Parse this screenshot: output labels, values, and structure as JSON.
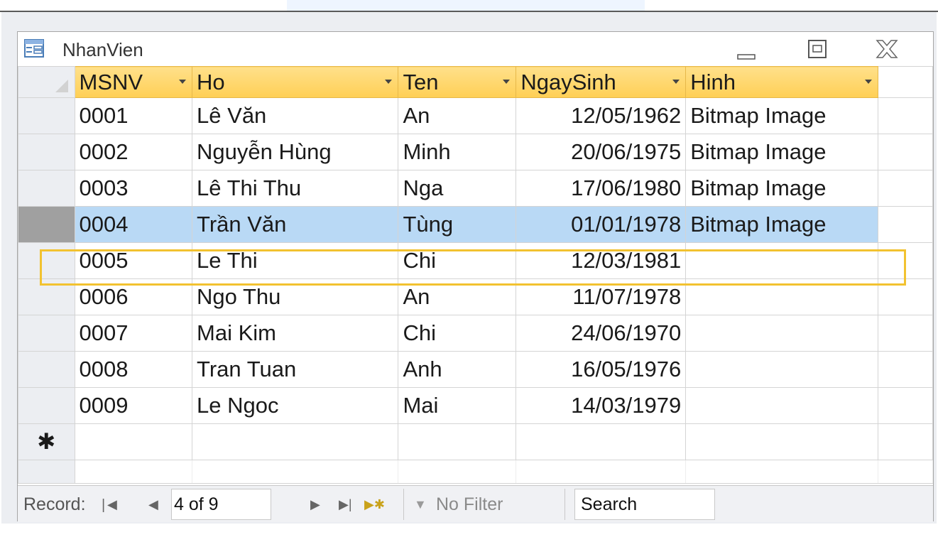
{
  "window": {
    "title": "NhanVien",
    "icon": "datasheet-icon",
    "controls": [
      "minimize-icon",
      "maximize-icon",
      "close-icon"
    ]
  },
  "table": {
    "columns": [
      "MSNV",
      "Ho",
      "Ten",
      "NgaySinh",
      "Hinh"
    ],
    "rows": [
      [
        "0001",
        "Lê Văn",
        "An",
        "12/05/1962",
        "Bitmap Image"
      ],
      [
        "0002",
        "Nguyễn Hùng",
        "Minh",
        "20/06/1975",
        "Bitmap Image"
      ],
      [
        "0003",
        "Lê Thi Thu",
        "Nga",
        "17/06/1980",
        "Bitmap Image"
      ],
      [
        "0004",
        "Trần Văn",
        "Tùng",
        "01/01/1978",
        "Bitmap Image"
      ],
      [
        "0005",
        "Le Thi",
        "Chi",
        "12/03/1981",
        ""
      ],
      [
        "0006",
        "Ngo Thu",
        "An",
        "11/07/1978",
        ""
      ],
      [
        "0007",
        "Mai Kim",
        "Chi",
        "24/06/1970",
        ""
      ],
      [
        "0008",
        "Tran Tuan",
        "Anh",
        "16/05/1976",
        ""
      ],
      [
        "0009",
        "Le Ngoc",
        "Mai",
        "14/03/1979",
        ""
      ]
    ],
    "selected_row": 4,
    "new_record_marker": "✱",
    "colors": {
      "header": "#ffd86b",
      "selected_row": "#b9d9f5",
      "selected_outline": "#f2c230"
    }
  },
  "navigation": {
    "record_label": "Record:",
    "position": "4 of 9",
    "filter_label": "No Filter",
    "search_placeholder": "Search"
  }
}
